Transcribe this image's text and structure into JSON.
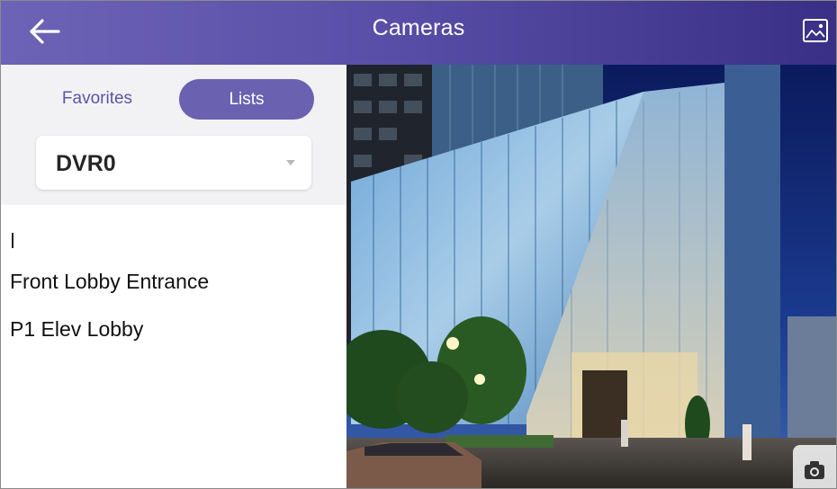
{
  "header": {
    "title": "Cameras",
    "back_icon": "arrow-left-icon",
    "gallery_icon": "image-gallery-icon"
  },
  "tabs": {
    "favorites_label": "Favorites",
    "lists_label": "Lists",
    "active": "Lists"
  },
  "dvr_select": {
    "value": "DVR0"
  },
  "camera_list": [
    {
      "label": "Front Lobby Entrance"
    },
    {
      "label": "P1 Elev Lobby"
    }
  ],
  "video": {
    "snapshot_icon": "camera-icon"
  },
  "colors": {
    "header_start": "#6d63b6",
    "header_end": "#3a2f86",
    "accent": "#6a62b0"
  }
}
